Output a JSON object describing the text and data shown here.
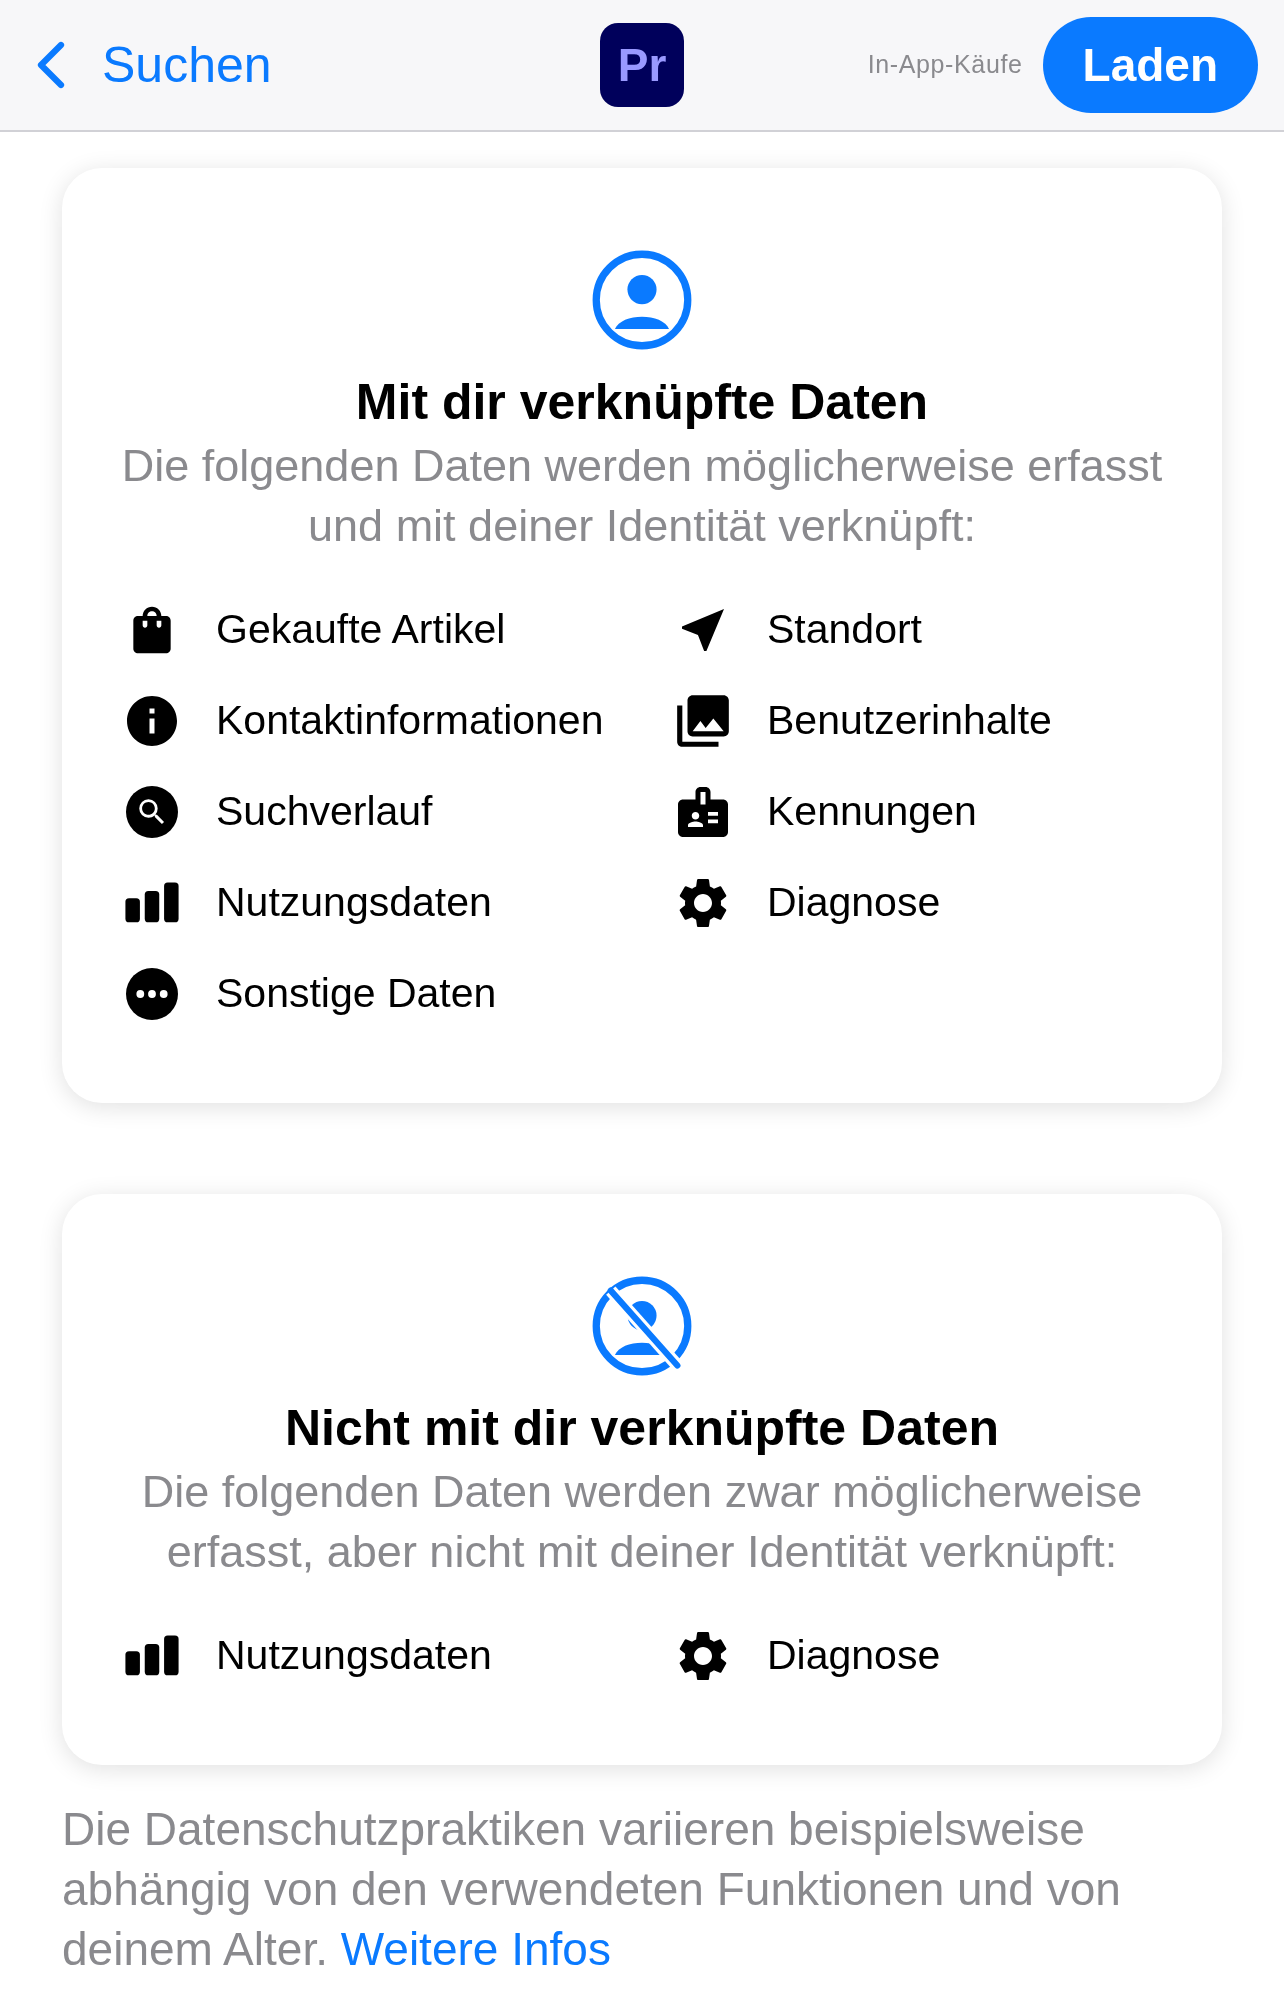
{
  "header": {
    "back_label": "Suchen",
    "app_icon_text": "Pr",
    "in_app_purchases": "In-App-Käufe",
    "get_button": "Laden"
  },
  "sections": [
    {
      "kind": "linked",
      "title": "Mit dir verknüpfte Daten",
      "subtitle": "Die folgenden Daten werden möglicherweise erfasst und mit deiner Identität verknüpft:",
      "items": [
        "Gekaufte Artikel",
        "Standort",
        "Kontaktinformationen",
        "Benutzerinhalte",
        "Suchverlauf",
        "Kennungen",
        "Nutzungsdaten",
        "Diagnose",
        "Sonstige Daten"
      ]
    },
    {
      "kind": "not_linked",
      "title": "Nicht mit dir verknüpfte Daten",
      "subtitle": "Die folgenden Daten werden zwar möglicherweise erfasst, aber nicht mit deiner Identität verknüpft:",
      "items": [
        "Nutzungsdaten",
        "Diagnose"
      ]
    }
  ],
  "footer": {
    "text": "Die Datenschutzpraktiken variieren beispielsweise abhängig von den verwendeten Funktionen und von deinem Alter.",
    "link": "Weitere Infos"
  }
}
